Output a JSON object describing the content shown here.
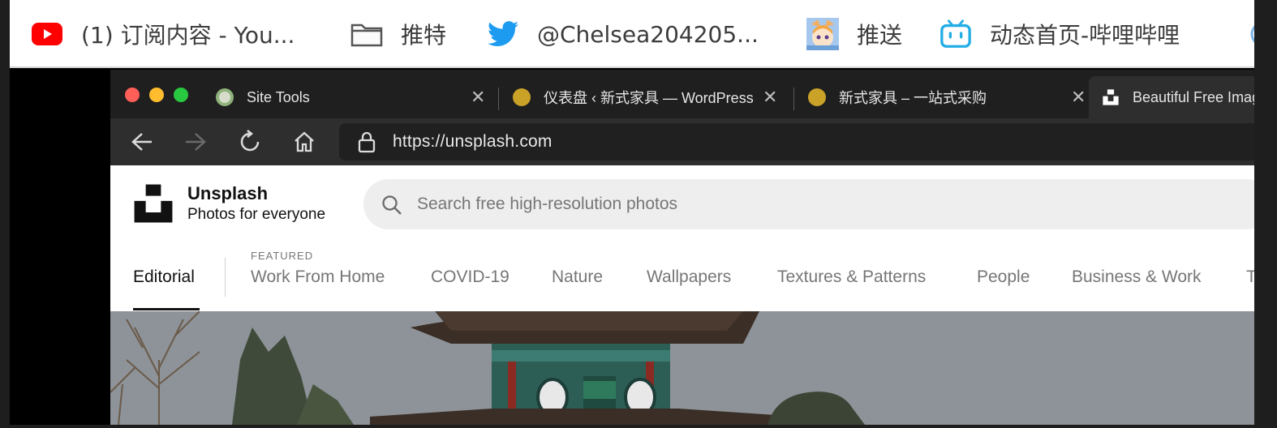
{
  "bookmarks": [
    {
      "label": "(1) 订阅内容 - You...",
      "icon": "youtube-icon"
    },
    {
      "label": "推特",
      "icon": "folder-icon"
    },
    {
      "label": "@Chelsea204205...",
      "icon": "twitter-icon"
    },
    {
      "label": "推送",
      "icon": "anime-avatar-icon"
    },
    {
      "label": "动态首页-哔哩哔哩",
      "icon": "bilibili-icon"
    }
  ],
  "tabs": [
    {
      "label": "Site Tools",
      "icon": "site-tools-icon"
    },
    {
      "label": "仪表盘 ‹ 新式家具 — WordPress",
      "icon": "wordpress-icon"
    },
    {
      "label": "新式家具 – 一站式采购",
      "icon": "wordpress-icon"
    },
    {
      "label": "Beautiful Free Images",
      "icon": "unsplash-icon"
    }
  ],
  "address": {
    "url": "https://unsplash.com"
  },
  "unsplash": {
    "brand_title": "Unsplash",
    "brand_subtitle": "Photos for everyone",
    "search_placeholder": "Search free high-resolution photos",
    "featured_label": "FEATURED",
    "categories": [
      "Editorial",
      "Work From Home",
      "COVID-19",
      "Nature",
      "Wallpapers",
      "Textures & Patterns",
      "People",
      "Business & Work",
      "T"
    ]
  },
  "colors": {
    "youtube": "#ff0000",
    "twitter": "#1d9bf0",
    "bilibili": "#23ade5",
    "traffic_red": "#ff5f57",
    "traffic_yellow": "#febc2e",
    "traffic_green": "#28c840"
  }
}
